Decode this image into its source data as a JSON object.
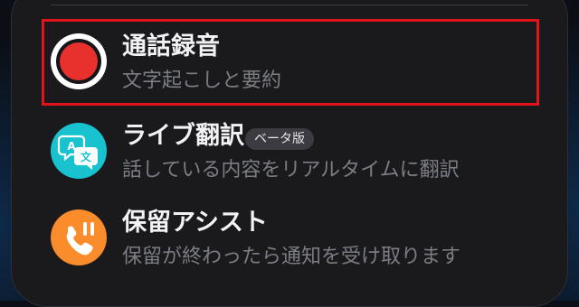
{
  "menu": {
    "items": [
      {
        "title": "通話録音",
        "subtitle": "文字起こしと要約",
        "icon": "record-icon",
        "color": "#e8302d",
        "highlighted": true
      },
      {
        "title": "ライブ翻訳",
        "badge": "ベータ版",
        "subtitle": "話している内容をリアルタイムに翻訳",
        "icon": "translate-icon",
        "color": "#18c3cf",
        "translate_glyphs": [
          "A",
          "文"
        ]
      },
      {
        "title": "保留アシスト",
        "subtitle": "保留が終わったら通知を受け取ります",
        "icon": "phone-hold-icon",
        "color": "#fb8c2b"
      }
    ],
    "highlight_color": "#e0141b"
  }
}
